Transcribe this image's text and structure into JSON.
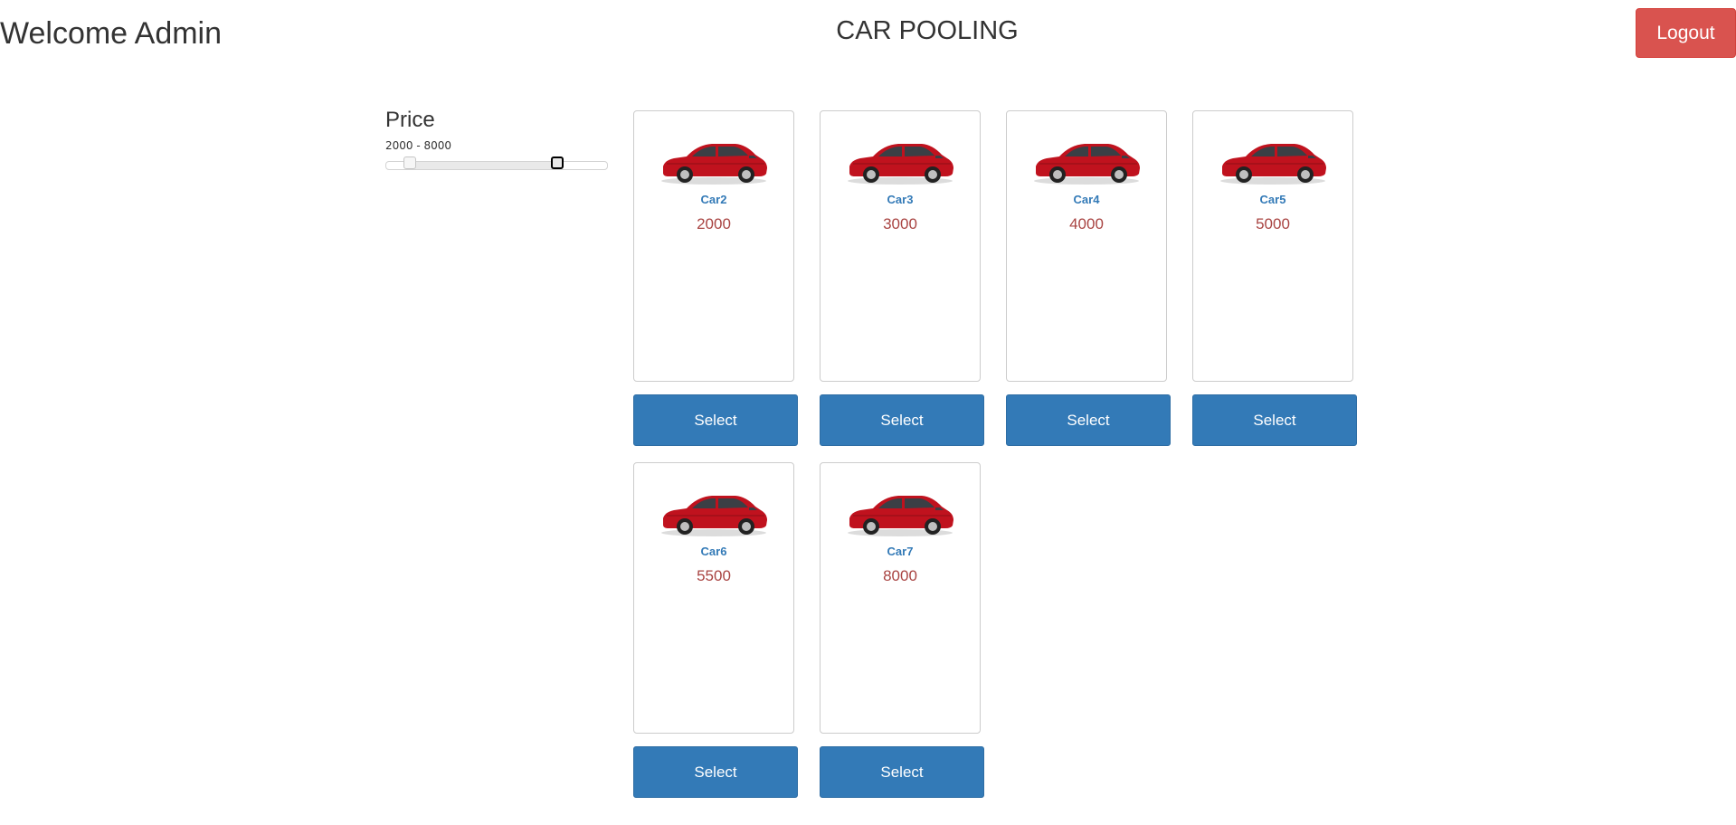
{
  "header": {
    "welcome_text": "Welcome Admin",
    "app_title": "CAR POOLING",
    "logout_label": "Logout"
  },
  "filter": {
    "title": "Price",
    "range_text": "2000 - 8000",
    "slider": {
      "scale_min": 0,
      "scale_max": 9000,
      "selected_min": 1000,
      "selected_max": 7000
    }
  },
  "cars": [
    {
      "name": "Car2",
      "price": "2000",
      "select_label": "Select"
    },
    {
      "name": "Car3",
      "price": "3000",
      "select_label": "Select"
    },
    {
      "name": "Car4",
      "price": "4000",
      "select_label": "Select"
    },
    {
      "name": "Car5",
      "price": "5000",
      "select_label": "Select"
    },
    {
      "name": "Car6",
      "price": "5500",
      "select_label": "Select"
    },
    {
      "name": "Car7",
      "price": "8000",
      "select_label": "Select"
    }
  ],
  "colors": {
    "logout": "#d9534f",
    "select": "#337ab7",
    "car_name": "#337ab7",
    "car_price": "#a94442",
    "car_body": "#c0121e"
  },
  "icons": {
    "car_image": "red-car-icon"
  }
}
